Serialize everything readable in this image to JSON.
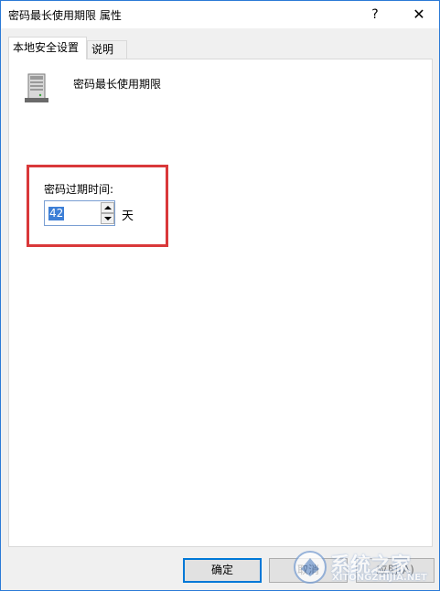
{
  "window": {
    "title": "密码最长使用期限 属性",
    "help_glyph": "?",
    "close_glyph": "✕"
  },
  "tabs": [
    {
      "label": "本地安全设置",
      "active": true
    },
    {
      "label": "说明",
      "active": false
    }
  ],
  "policy": {
    "icon": "server-icon",
    "name": "密码最长使用期限"
  },
  "setting": {
    "label": "密码过期时间:",
    "value": "42",
    "unit": "天",
    "highlight_color": "#d9383a"
  },
  "buttons": {
    "ok": "确定",
    "cancel": "取消",
    "apply": "应用(A)"
  },
  "watermark": {
    "text": "系统之家",
    "url": "XITONGZHIJIA.NET"
  },
  "colors": {
    "accent": "#0078d7",
    "selection": "#3d7fd6"
  }
}
